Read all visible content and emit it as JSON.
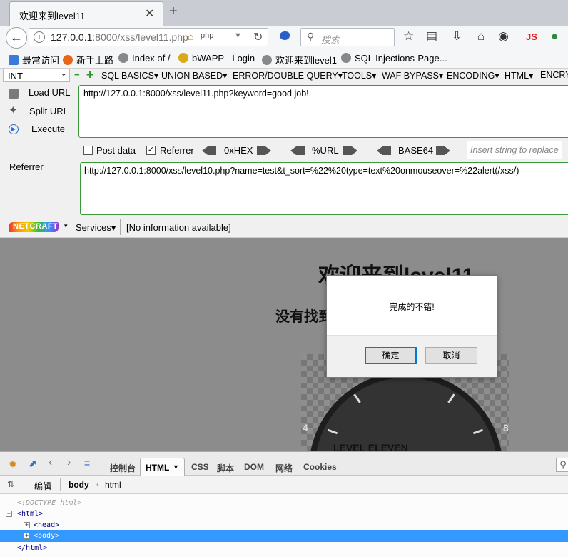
{
  "tab": {
    "title": "欢迎来到level11",
    "close": "✕",
    "new": "+"
  },
  "nav": {
    "url_host": "127.0.0.1",
    "url_rest": ":8000/xss/level11.php",
    "php_badge": "php",
    "search_placeholder": "搜索",
    "js_label": "JS"
  },
  "bookmarks": [
    {
      "label": "最常访问",
      "color": "#3b7ad8"
    },
    {
      "label": "新手上路",
      "color": "#e8651c"
    },
    {
      "label": "Index of /",
      "color": "#777777"
    },
    {
      "label": "bWAPP - Login",
      "color": "#d9a91a"
    },
    {
      "label": "欢迎来到level1",
      "color": "#777777"
    },
    {
      "label": "SQL Injections-Page...",
      "color": "#777777"
    }
  ],
  "hackbar": {
    "int_value": "INT",
    "menus": [
      "SQL BASICS",
      "UNION BASED",
      "ERROR/DOUBLE QUERY",
      "TOOLS",
      "WAF BYPASS",
      "ENCODING",
      "HTML",
      "ENCRY"
    ],
    "load_url": "Load URL",
    "split_url": "Split URL",
    "execute": "Execute",
    "url_value": "http://127.0.0.1:8000/xss/level11.php?keyword=good job!",
    "post_data": "Post data",
    "referrer_chk": "Referrer",
    "hex": "0xHEX",
    "url_enc": "%URL",
    "base64": "BASE64",
    "insert_placeholder": "Insert string to replace",
    "referrer_label": "Referrer",
    "referrer_value": "http://127.0.0.1:8000/xss/level10.php?name=test&t_sort=%22%20type=text%20onmouseover=%22alert(/xss/)"
  },
  "netcraft": {
    "logo": "NETCRAFT",
    "services": "Services",
    "info": "[No information available]"
  },
  "page": {
    "heading": "欢迎来到level11",
    "subheading": "没有找到和good job!相关的结果.",
    "gauge_left": "4",
    "gauge_right": "8",
    "gauge_text": "LEVEL ELEVEN"
  },
  "dialog": {
    "message": "完成的不错!",
    "ok": "确定",
    "cancel": "取消"
  },
  "devtools": {
    "tabs": [
      "控制台",
      "HTML",
      "CSS",
      "脚本",
      "DOM",
      "网络",
      "Cookies"
    ],
    "edit": "编辑",
    "crumb_body": "body",
    "crumb_html": "html",
    "doctype": "<!DOCTYPE html>",
    "html_open": "<html>",
    "head": "<head>",
    "body": "<body>",
    "html_close": "</html>"
  }
}
